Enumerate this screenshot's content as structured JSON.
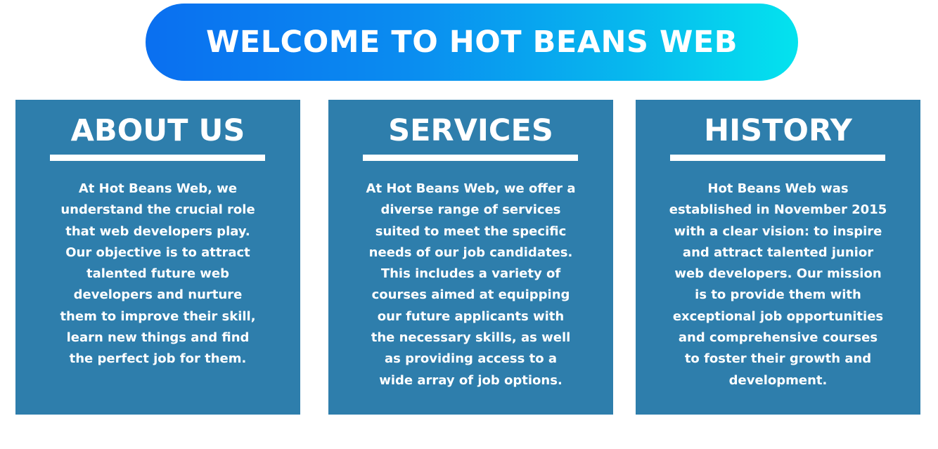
{
  "banner": {
    "title": "WELCOME TO HOT BEANS WEB"
  },
  "sections": [
    {
      "title": "ABOUT US",
      "body": "At Hot Beans Web, we\nunderstand the crucial role\nthat web developers play.\nOur objective is to attract\ntalented future web\ndevelopers and nurture\nthem to improve their skill,\nlearn new things  and find\nthe perfect job for them."
    },
    {
      "title": "SERVICES",
      "body": "At Hot Beans Web, we offer a\ndiverse range of services\nsuited to meet the specific\nneeds of our job candidates.\nThis includes a variety of\ncourses aimed at equipping\nour future applicants with\nthe necessary skills, as well\nas providing access to a\nwide array of job options."
    },
    {
      "title": "HISTORY",
      "body": "Hot Beans Web was\nestablished in November 2015\nwith a clear vision: to inspire\nand attract talented junior\nweb developers. Our mission\nis to provide them with\nexceptional job opportunities\nand comprehensive courses\nto foster their growth and\ndevelopment."
    }
  ]
}
